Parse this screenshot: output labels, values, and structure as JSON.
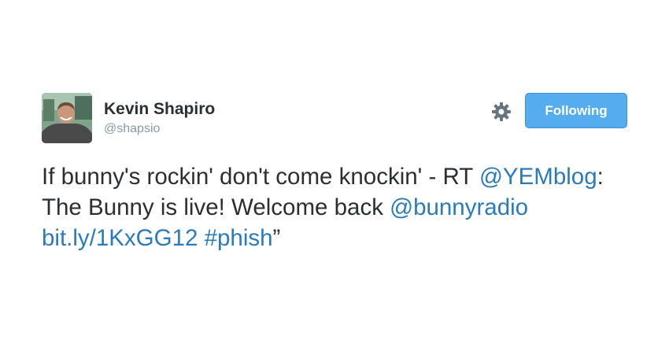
{
  "colors": {
    "text": "#292f33",
    "link": "#2b7bb9",
    "muted": "#8899a6",
    "follow_button": "#55acee"
  },
  "user": {
    "display_name": "Kevin Shapiro",
    "screen_name": "@shapsio",
    "avatar_icon": "user-avatar-photo"
  },
  "actions": {
    "settings_icon": "gear-icon",
    "follow_label": "Following"
  },
  "tweet": {
    "text_1": "If bunny's rockin' don't come knockin' - RT ",
    "mention_1": "@YEMblog",
    "text_2": ": The Bunny is live! Welcome back ",
    "mention_2": "@bunnyradio",
    "text_3": " ",
    "url": "bit.ly/1KxGG12",
    "text_4": " ",
    "hashtag": "#phish",
    "text_5": "”"
  }
}
